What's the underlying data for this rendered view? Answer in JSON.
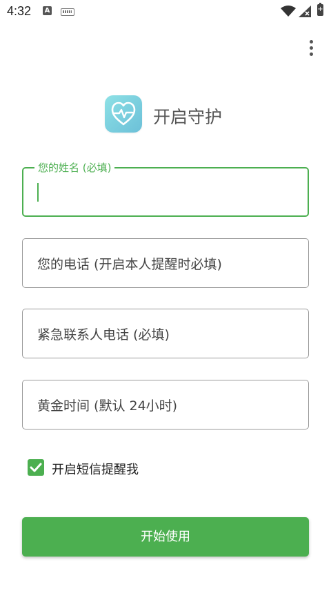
{
  "status_bar": {
    "time": "4:32",
    "notification_letter": "A",
    "battery_glyph": "+"
  },
  "header": {
    "logo_icon": "heart-pulse-icon",
    "title": "开启守护"
  },
  "form": {
    "name_field": {
      "label": "您的姓名 (必填)",
      "value": ""
    },
    "phone_field": {
      "placeholder": "您的电话 (开启本人提醒时必填)"
    },
    "emergency_field": {
      "placeholder": "紧急联系人电话 (必填)"
    },
    "golden_time_field": {
      "placeholder": "黄金时间 (默认 24小时)"
    },
    "sms_checkbox": {
      "label": "开启短信提醒我",
      "checked": true
    }
  },
  "start_button": {
    "label": "开始使用"
  },
  "colors": {
    "accent": "#4caf50",
    "logo_gradient_start": "#8fe2e6",
    "logo_gradient_end": "#6cc0d8",
    "title_text": "#555555"
  }
}
